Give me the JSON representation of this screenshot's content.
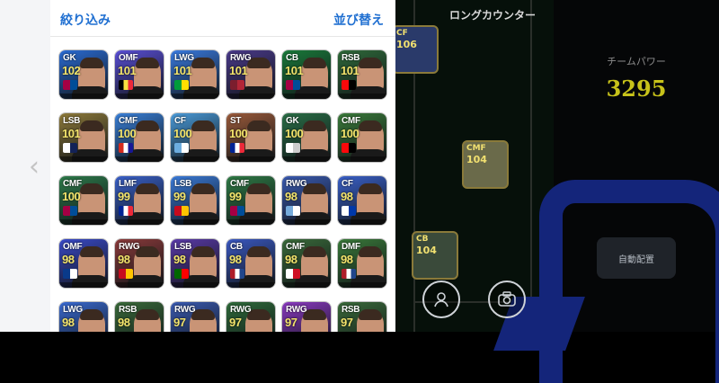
{
  "header": {
    "filter_label": "絞り込み",
    "sort_label": "並び替え"
  },
  "pitch": {
    "title": "ロングカウンター"
  },
  "team_power": {
    "label": "チームパワー",
    "value": "3295"
  },
  "buttons": {
    "auto_place": "自動配置"
  },
  "colors": {
    "accent": "#1f6fd1",
    "power": "#c7c21a",
    "field_bg": "#06100a",
    "brand_blue": "#14257a"
  },
  "players": [
    {
      "pos": "GK",
      "ovr": "102",
      "bg": "#2b6cd4",
      "flag": [
        "#a50044",
        "#004d98"
      ]
    },
    {
      "pos": "OMF",
      "ovr": "101",
      "bg": "#5a4fd6",
      "flag": [
        "#000",
        "#fae042",
        "#ed2939"
      ]
    },
    {
      "pos": "LWG",
      "ovr": "101",
      "bg": "#3a7be0",
      "flag": [
        "#009c3b",
        "#ffdf00"
      ]
    },
    {
      "pos": "RWG",
      "ovr": "101",
      "bg": "#4a3a8a",
      "flag": [
        "#7b1e2e",
        "#b32637"
      ]
    },
    {
      "pos": "CB",
      "ovr": "101",
      "bg": "#1a7a3a",
      "flag": [
        "#a50044",
        "#004d98"
      ]
    },
    {
      "pos": "RSB",
      "ovr": "101",
      "bg": "#2f6a3a",
      "flag": [
        "#fb090b",
        "#000"
      ]
    },
    {
      "pos": "LSB",
      "ovr": "101",
      "bg": "#8e7a3a",
      "flag": [
        "#fff",
        "#132257"
      ]
    },
    {
      "pos": "CMF",
      "ovr": "100",
      "bg": "#3a80d8",
      "flag": [
        "#d52b1e",
        "#fff",
        "#171796"
      ]
    },
    {
      "pos": "CF",
      "ovr": "100",
      "bg": "#4a9ad8",
      "flag": [
        "#6caddf",
        "#fff"
      ]
    },
    {
      "pos": "ST",
      "ovr": "100",
      "bg": "#9a5a3a",
      "flag": [
        "#002395",
        "#fff",
        "#ed2939"
      ]
    },
    {
      "pos": "GK",
      "ovr": "100",
      "bg": "#2a6e46",
      "flag": [
        "#fff",
        "#ccc"
      ]
    },
    {
      "pos": "CMF",
      "ovr": "100",
      "bg": "#3a7a3a",
      "flag": [
        "#fb090b",
        "#000"
      ]
    },
    {
      "pos": "CMF",
      "ovr": "100",
      "bg": "#2d7a4a",
      "flag": [
        "#a50044",
        "#004d98"
      ]
    },
    {
      "pos": "LMF",
      "ovr": "99",
      "bg": "#3a60c8",
      "flag": [
        "#002395",
        "#fff",
        "#ed2939"
      ]
    },
    {
      "pos": "LSB",
      "ovr": "99",
      "bg": "#3a7ad8",
      "flag": [
        "#c60b1e",
        "#ffc400"
      ]
    },
    {
      "pos": "CMF",
      "ovr": "99",
      "bg": "#2f7a45",
      "flag": [
        "#a50044",
        "#004d98"
      ]
    },
    {
      "pos": "RWG",
      "ovr": "98",
      "bg": "#3a5ab0",
      "flag": [
        "#75aadb",
        "#fff"
      ]
    },
    {
      "pos": "CF",
      "ovr": "98",
      "bg": "#3a60c8",
      "flag": [
        "#fff",
        "#0038a8"
      ]
    },
    {
      "pos": "OMF",
      "ovr": "98",
      "bg": "#3a4ac8",
      "flag": [
        "#0a3a8a",
        "#fff"
      ]
    },
    {
      "pos": "RWG",
      "ovr": "98",
      "bg": "#8a3a3a",
      "flag": [
        "#c60b1e",
        "#ffc400"
      ]
    },
    {
      "pos": "LSB",
      "ovr": "98",
      "bg": "#5a3aa8",
      "flag": [
        "#006600",
        "#ff0000"
      ]
    },
    {
      "pos": "CB",
      "ovr": "98",
      "bg": "#3a58c0",
      "flag": [
        "#ae1c28",
        "#fff",
        "#21468b"
      ]
    },
    {
      "pos": "CMF",
      "ovr": "98",
      "bg": "#3a6a3a",
      "flag": [
        "#fff",
        "#ce1124"
      ]
    },
    {
      "pos": "DMF",
      "ovr": "98",
      "bg": "#3a7a3a",
      "flag": [
        "#ae1c28",
        "#fff",
        "#21468b"
      ]
    },
    {
      "pos": "LWG",
      "ovr": "98",
      "bg": "#3a6ad0",
      "flag": [
        "#fff",
        "#ccc"
      ]
    },
    {
      "pos": "RSB",
      "ovr": "98",
      "bg": "#3a6a3a",
      "flag": [
        "#fff",
        "#ccc"
      ]
    },
    {
      "pos": "RWG",
      "ovr": "97",
      "bg": "#3a5ab0",
      "flag": [
        "#fff",
        "#ccc"
      ]
    },
    {
      "pos": "RWG",
      "ovr": "97",
      "bg": "#2f6a3a",
      "flag": [
        "#fff",
        "#ccc"
      ]
    },
    {
      "pos": "RWG",
      "ovr": "97",
      "bg": "#8a3ac0",
      "flag": [
        "#fff",
        "#ccc"
      ]
    },
    {
      "pos": "RSB",
      "ovr": "97",
      "bg": "#3a6a3a",
      "flag": [
        "#fff",
        "#ccc"
      ]
    }
  ],
  "pitch_cards": [
    {
      "pos": "CF",
      "ovr": "106"
    },
    {
      "pos": "CMF",
      "ovr": "104"
    },
    {
      "pos": "CB",
      "ovr": "104"
    }
  ]
}
